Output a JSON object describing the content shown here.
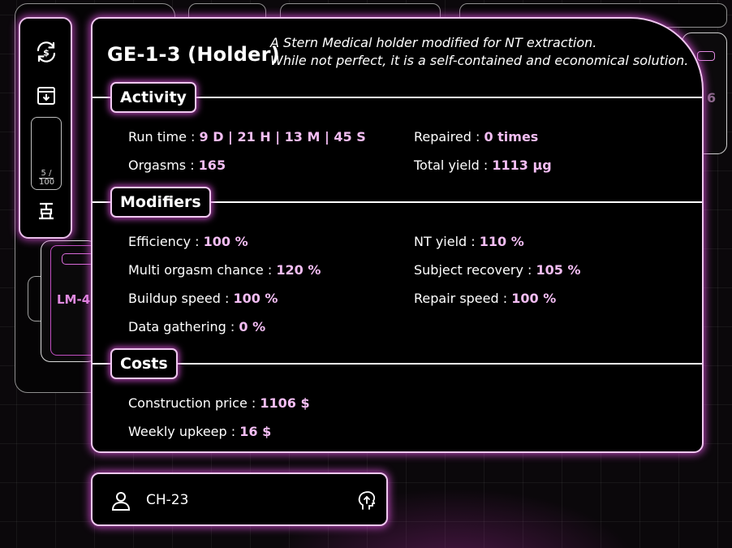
{
  "card": {
    "title": "GE-1-3 (Holder)",
    "description_line1": "A Stern Medical holder modified for NT extraction.",
    "description_line2": "While not perfect, it is a self-contained and economical solution."
  },
  "toolbar": {
    "icons": [
      "sync-icon",
      "download-box-icon",
      "pipeline-icon"
    ],
    "slot_count": "5 /",
    "slot_capacity": "100"
  },
  "sections": {
    "activity": {
      "title": "Activity",
      "run_time_label": "Run time : ",
      "run_time_value": "9 D | 21 H | 13 M | 45 S",
      "repaired_label": "Repaired : ",
      "repaired_value": "0 times",
      "orgasms_label": "Orgasms : ",
      "orgasms_value": "165",
      "total_yield_label": "Total yield : ",
      "total_yield_value": "1113 µg"
    },
    "modifiers": {
      "title": "Modifiers",
      "efficiency_label": "Efficiency : ",
      "efficiency_value": "100 %",
      "nt_yield_label": "NT yield : ",
      "nt_yield_value": "110 %",
      "multi_orgasm_label": "Multi orgasm chance : ",
      "multi_orgasm_value": "120 %",
      "subject_recovery_label": "Subject recovery : ",
      "subject_recovery_value": "105 %",
      "buildup_speed_label": "Buildup speed : ",
      "buildup_speed_value": "100 %",
      "repair_speed_label": "Repair speed : ",
      "repair_speed_value": "100 %",
      "data_gathering_label": "Data gathering : ",
      "data_gathering_value": "0 %"
    },
    "costs": {
      "title": "Costs",
      "construction_label": "Construction price : ",
      "construction_value": "1106 $",
      "upkeep_label": "Weekly upkeep : ",
      "upkeep_value": "16 $"
    }
  },
  "bottom_bar": {
    "subject_name": "CH-23",
    "icons": [
      "person-icon",
      "head-upload-icon"
    ]
  },
  "background": {
    "left_card_label": "LM-4",
    "right_card_number": "6"
  },
  "colors": {
    "accent_glow": "#d750d7",
    "border": "#f0c8f0",
    "value_text": "#f3bdf3",
    "background": "#0b080b"
  }
}
